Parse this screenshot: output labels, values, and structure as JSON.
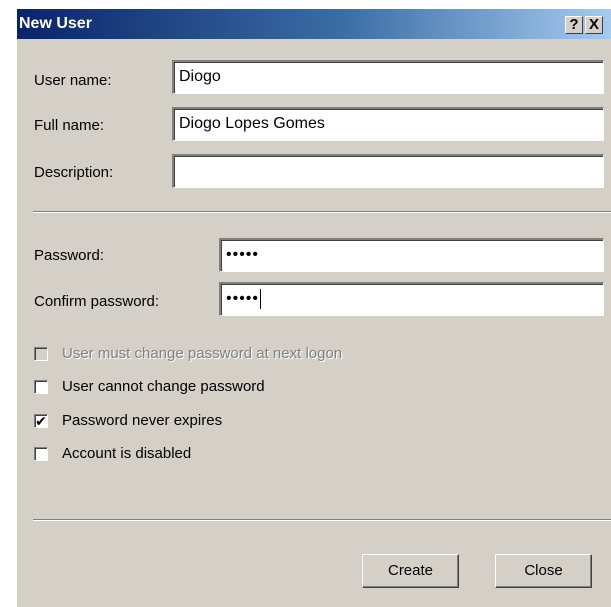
{
  "window": {
    "title": "New User",
    "help_button": "?",
    "close_button": "X"
  },
  "fields": {
    "username": {
      "label": "User name:",
      "value": "Diogo"
    },
    "fullname": {
      "label": "Full name:",
      "value": "Diogo Lopes Gomes"
    },
    "description": {
      "label": "Description:",
      "value": ""
    },
    "password": {
      "label": "Password:",
      "value": "•••••"
    },
    "confirm": {
      "label": "Confirm password:",
      "value": "•••••"
    }
  },
  "options": {
    "must_change": {
      "label": "User must change password at next logon",
      "checked": false,
      "enabled": false
    },
    "cannot_change": {
      "label": "User cannot change password",
      "checked": false,
      "enabled": true
    },
    "never_expires": {
      "label": "Password never expires",
      "checked": true,
      "enabled": true
    },
    "disabled": {
      "label": "Account is disabled",
      "checked": false,
      "enabled": true
    }
  },
  "buttons": {
    "create": "Create",
    "close": "Close"
  },
  "colors": {
    "dialog_bg": "#d4d0c8",
    "title_start": "#0a246a",
    "title_end": "#a6caf0"
  }
}
